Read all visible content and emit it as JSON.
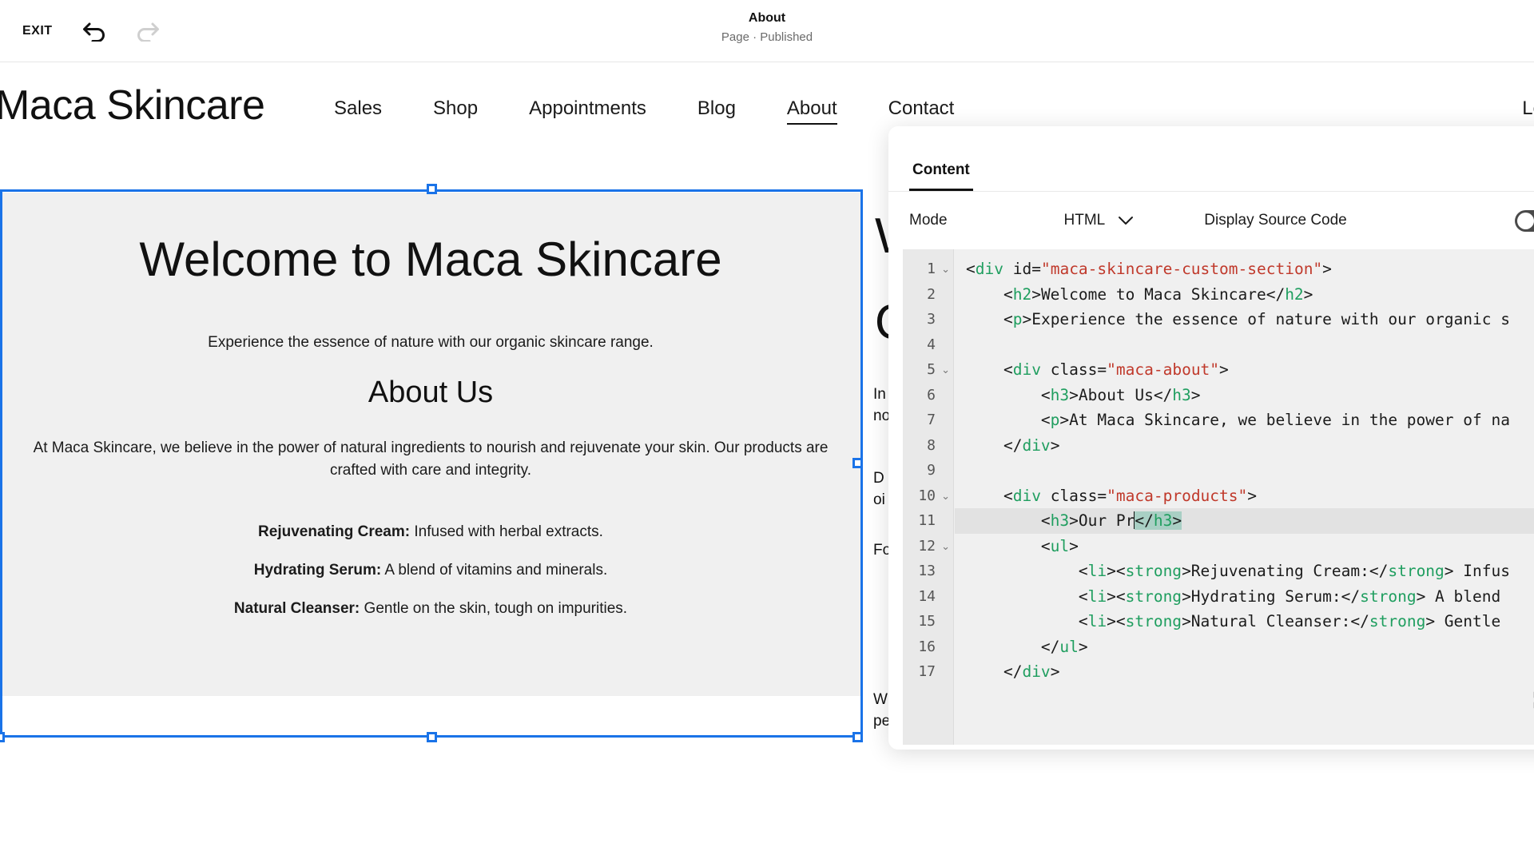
{
  "topbar": {
    "exit_label": "EXIT",
    "undo_icon": "undo-arrow-icon",
    "redo_icon": "redo-arrow-icon",
    "title": "About",
    "subtitle": "Page · Published"
  },
  "site": {
    "brand": "Maca Skincare",
    "nav": [
      {
        "label": "Sales",
        "active": false
      },
      {
        "label": "Shop",
        "active": false
      },
      {
        "label": "Appointments",
        "active": false
      },
      {
        "label": "Blog",
        "active": false
      },
      {
        "label": "About",
        "active": true
      },
      {
        "label": "Contact",
        "active": false
      }
    ],
    "login_label": "Lo"
  },
  "section": {
    "heading": "Welcome to Maca Skincare",
    "lead": "Experience the essence of nature with our organic skincare range.",
    "about_heading": "About Us",
    "about_paragraph": "At Maca Skincare, we believe in the power of natural ingredients to nourish and rejuvenate your skin. Our products are crafted with care and integrity.",
    "products": [
      {
        "name": "Rejuvenating Cream:",
        "desc": " Infused with herbal extracts."
      },
      {
        "name": "Hydrating Serum:",
        "desc": " A blend of vitamins and minerals."
      },
      {
        "name": "Natural Cleanser:",
        "desc": " Gentle on the skin, tough on impurities."
      }
    ],
    "selection_color": "#1a73e8",
    "background_color": "#f0f0f0"
  },
  "background_page": {
    "line_w": "W",
    "line_o": "O",
    "l1": "In",
    "l2": "no",
    "l3": "D",
    "l4": "oi",
    "l5": "Fo",
    "l6": "W",
    "l7": "pe"
  },
  "panel": {
    "tab_label": "Content",
    "mode_label": "Mode",
    "mode_value": "HTML",
    "mode_chevron": "chevron-down-icon",
    "display_source_label": "Display Source Code",
    "display_source_enabled": false,
    "expand_icon": "expand-fullscreen-icon",
    "cursor_line": 11,
    "lines": [
      {
        "n": 1,
        "fold": true,
        "indent": 0,
        "tokens": [
          {
            "t": "pn",
            "v": "<"
          },
          {
            "t": "tg",
            "v": "div"
          },
          {
            "t": "pn",
            "v": " "
          },
          {
            "t": "at",
            "v": "id"
          },
          {
            "t": "pn",
            "v": "="
          },
          {
            "t": "st",
            "v": "\"maca-skincare-custom-section\""
          },
          {
            "t": "pn",
            "v": ">"
          }
        ]
      },
      {
        "n": 2,
        "fold": false,
        "indent": 1,
        "tokens": [
          {
            "t": "pn",
            "v": "<"
          },
          {
            "t": "tg",
            "v": "h2"
          },
          {
            "t": "pn",
            "v": ">Welcome to Maca Skincare</"
          },
          {
            "t": "tg",
            "v": "h2"
          },
          {
            "t": "pn",
            "v": ">"
          }
        ]
      },
      {
        "n": 3,
        "fold": false,
        "indent": 1,
        "tokens": [
          {
            "t": "pn",
            "v": "<"
          },
          {
            "t": "tg",
            "v": "p"
          },
          {
            "t": "pn",
            "v": ">Experience the essence of nature with our organic s"
          }
        ]
      },
      {
        "n": 4,
        "fold": false,
        "indent": 0,
        "tokens": []
      },
      {
        "n": 5,
        "fold": true,
        "indent": 1,
        "tokens": [
          {
            "t": "pn",
            "v": "<"
          },
          {
            "t": "tg",
            "v": "div"
          },
          {
            "t": "pn",
            "v": " "
          },
          {
            "t": "at",
            "v": "class"
          },
          {
            "t": "pn",
            "v": "="
          },
          {
            "t": "st",
            "v": "\"maca-about\""
          },
          {
            "t": "pn",
            "v": ">"
          }
        ]
      },
      {
        "n": 6,
        "fold": false,
        "indent": 2,
        "tokens": [
          {
            "t": "pn",
            "v": "<"
          },
          {
            "t": "tg",
            "v": "h3"
          },
          {
            "t": "pn",
            "v": ">About Us</"
          },
          {
            "t": "tg",
            "v": "h3"
          },
          {
            "t": "pn",
            "v": ">"
          }
        ]
      },
      {
        "n": 7,
        "fold": false,
        "indent": 2,
        "tokens": [
          {
            "t": "pn",
            "v": "<"
          },
          {
            "t": "tg",
            "v": "p"
          },
          {
            "t": "pn",
            "v": ">At Maca Skincare, we believe in the power of na"
          }
        ]
      },
      {
        "n": 8,
        "fold": false,
        "indent": 1,
        "tokens": [
          {
            "t": "pn",
            "v": "</"
          },
          {
            "t": "tg",
            "v": "div"
          },
          {
            "t": "pn",
            "v": ">"
          }
        ]
      },
      {
        "n": 9,
        "fold": false,
        "indent": 0,
        "tokens": []
      },
      {
        "n": 10,
        "fold": true,
        "indent": 1,
        "tokens": [
          {
            "t": "pn",
            "v": "<"
          },
          {
            "t": "tg",
            "v": "div"
          },
          {
            "t": "pn",
            "v": " "
          },
          {
            "t": "at",
            "v": "class"
          },
          {
            "t": "pn",
            "v": "="
          },
          {
            "t": "st",
            "v": "\"maca-products\""
          },
          {
            "t": "pn",
            "v": ">"
          }
        ]
      },
      {
        "n": 11,
        "fold": false,
        "indent": 2,
        "tokens": [
          {
            "t": "pn",
            "v": "<"
          },
          {
            "t": "tg",
            "v": "h3"
          },
          {
            "t": "pn",
            "v": ">Our Pr"
          },
          {
            "t": "caret",
            "v": ""
          },
          {
            "t": "selhi-pn",
            "v": "</"
          },
          {
            "t": "selhi-tg",
            "v": "h3"
          },
          {
            "t": "selhi-pn",
            "v": ">"
          }
        ]
      },
      {
        "n": 12,
        "fold": true,
        "indent": 2,
        "tokens": [
          {
            "t": "pn",
            "v": "<"
          },
          {
            "t": "tg",
            "v": "ul"
          },
          {
            "t": "pn",
            "v": ">"
          }
        ]
      },
      {
        "n": 13,
        "fold": false,
        "indent": 3,
        "tokens": [
          {
            "t": "pn",
            "v": "<"
          },
          {
            "t": "tg",
            "v": "li"
          },
          {
            "t": "pn",
            "v": "><"
          },
          {
            "t": "tg",
            "v": "strong"
          },
          {
            "t": "pn",
            "v": ">Rejuvenating Cream:</"
          },
          {
            "t": "tg",
            "v": "strong"
          },
          {
            "t": "pn",
            "v": "> Infus"
          }
        ]
      },
      {
        "n": 14,
        "fold": false,
        "indent": 3,
        "tokens": [
          {
            "t": "pn",
            "v": "<"
          },
          {
            "t": "tg",
            "v": "li"
          },
          {
            "t": "pn",
            "v": "><"
          },
          {
            "t": "tg",
            "v": "strong"
          },
          {
            "t": "pn",
            "v": ">Hydrating Serum:</"
          },
          {
            "t": "tg",
            "v": "strong"
          },
          {
            "t": "pn",
            "v": "> A blend"
          }
        ]
      },
      {
        "n": 15,
        "fold": false,
        "indent": 3,
        "tokens": [
          {
            "t": "pn",
            "v": "<"
          },
          {
            "t": "tg",
            "v": "li"
          },
          {
            "t": "pn",
            "v": "><"
          },
          {
            "t": "tg",
            "v": "strong"
          },
          {
            "t": "pn",
            "v": ">Natural Cleanser:</"
          },
          {
            "t": "tg",
            "v": "strong"
          },
          {
            "t": "pn",
            "v": "> Gentle"
          }
        ]
      },
      {
        "n": 16,
        "fold": false,
        "indent": 2,
        "tokens": [
          {
            "t": "pn",
            "v": "</"
          },
          {
            "t": "tg",
            "v": "ul"
          },
          {
            "t": "pn",
            "v": ">"
          }
        ]
      },
      {
        "n": 17,
        "fold": false,
        "indent": 1,
        "tokens": [
          {
            "t": "pn",
            "v": "</"
          },
          {
            "t": "tg",
            "v": "div"
          },
          {
            "t": "pn",
            "v": ">"
          }
        ]
      }
    ]
  }
}
